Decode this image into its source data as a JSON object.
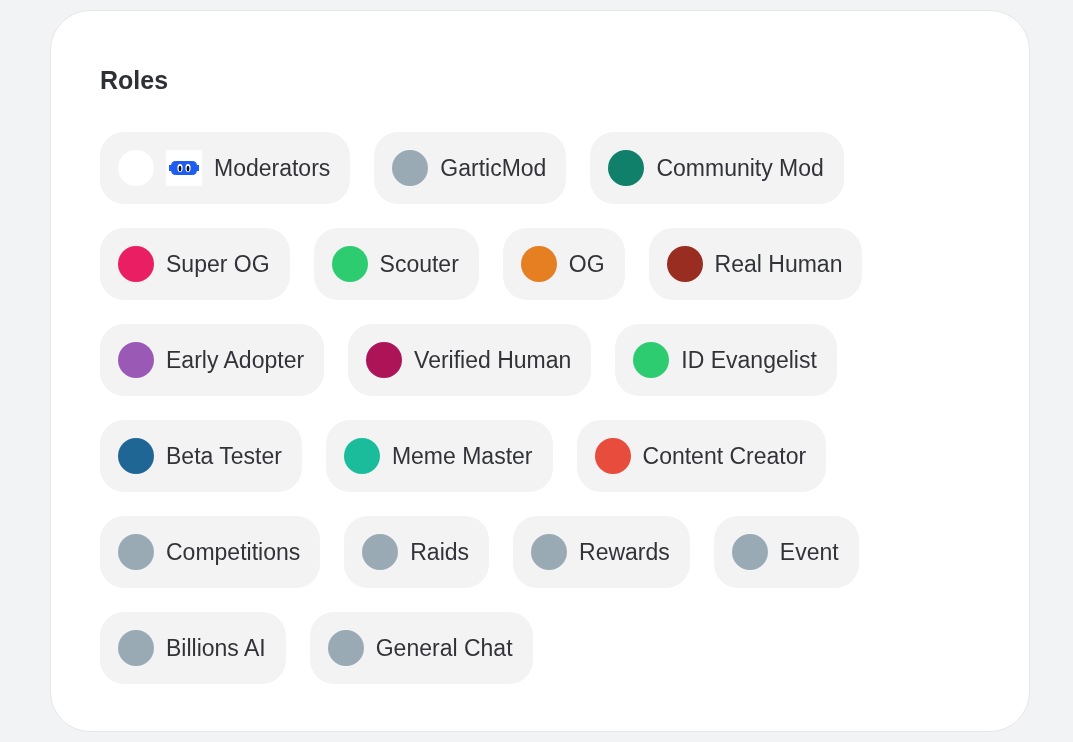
{
  "title": "Roles",
  "rows": [
    [
      {
        "name": "Moderators",
        "color": "#ffffff",
        "badge": true
      },
      {
        "name": "GarticMod",
        "color": "#99aab5",
        "badge": false
      },
      {
        "name": "Community Mod",
        "color": "#11806a",
        "badge": false
      }
    ],
    [
      {
        "name": "Super OG",
        "color": "#e91e63",
        "badge": false
      },
      {
        "name": "Scouter",
        "color": "#2ecc71",
        "badge": false
      },
      {
        "name": "OG",
        "color": "#e67e22",
        "badge": false
      },
      {
        "name": "Real Human",
        "color": "#992d22",
        "badge": false
      }
    ],
    [
      {
        "name": "Early Adopter",
        "color": "#9b59b6",
        "badge": false
      },
      {
        "name": "Verified Human",
        "color": "#ad1457",
        "badge": false
      },
      {
        "name": "ID Evangelist",
        "color": "#2ecc71",
        "badge": false
      }
    ],
    [
      {
        "name": "Beta Tester",
        "color": "#206694",
        "badge": false
      },
      {
        "name": "Meme Master",
        "color": "#1abc9c",
        "badge": false
      },
      {
        "name": "Content Creator",
        "color": "#e74c3c",
        "badge": false
      }
    ],
    [
      {
        "name": "Competitions",
        "color": "#99aab5",
        "badge": false
      },
      {
        "name": "Raids",
        "color": "#99aab5",
        "badge": false
      },
      {
        "name": "Rewards",
        "color": "#99aab5",
        "badge": false
      },
      {
        "name": "Event",
        "color": "#99aab5",
        "badge": false
      }
    ],
    [
      {
        "name": "Billions AI",
        "color": "#99aab5",
        "badge": false
      },
      {
        "name": "General Chat",
        "color": "#99aab5",
        "badge": false
      }
    ]
  ]
}
